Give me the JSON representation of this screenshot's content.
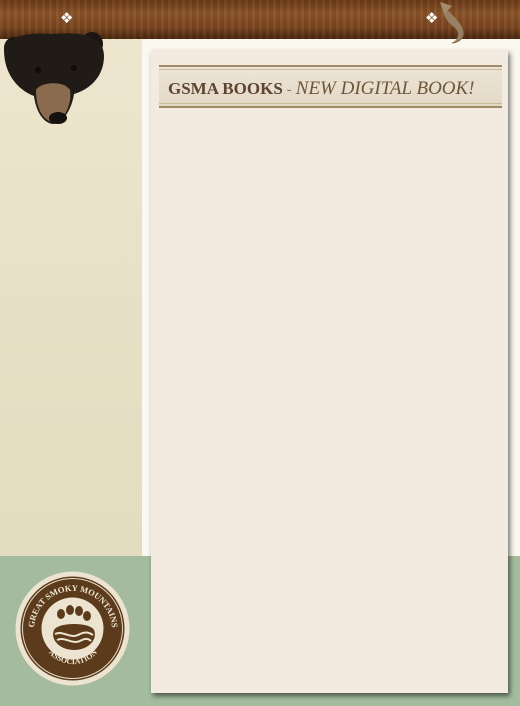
{
  "header": {
    "section": "GSMA BOOKS",
    "separator": "-",
    "title": "NEW DIGITAL BOOK!"
  },
  "topbar": {
    "left_ornament": "❖",
    "right_ornament": "❖"
  },
  "logo": {
    "name": "GREAT SMOKY MOUNTAINS",
    "sub": "ASSOCIATION"
  },
  "colors": {
    "topbar": "#7a4520",
    "sidebar": "#e4dcc2",
    "card": "#f3ebdf",
    "green": "#a5bd9f",
    "title_text": "#5d4330"
  }
}
